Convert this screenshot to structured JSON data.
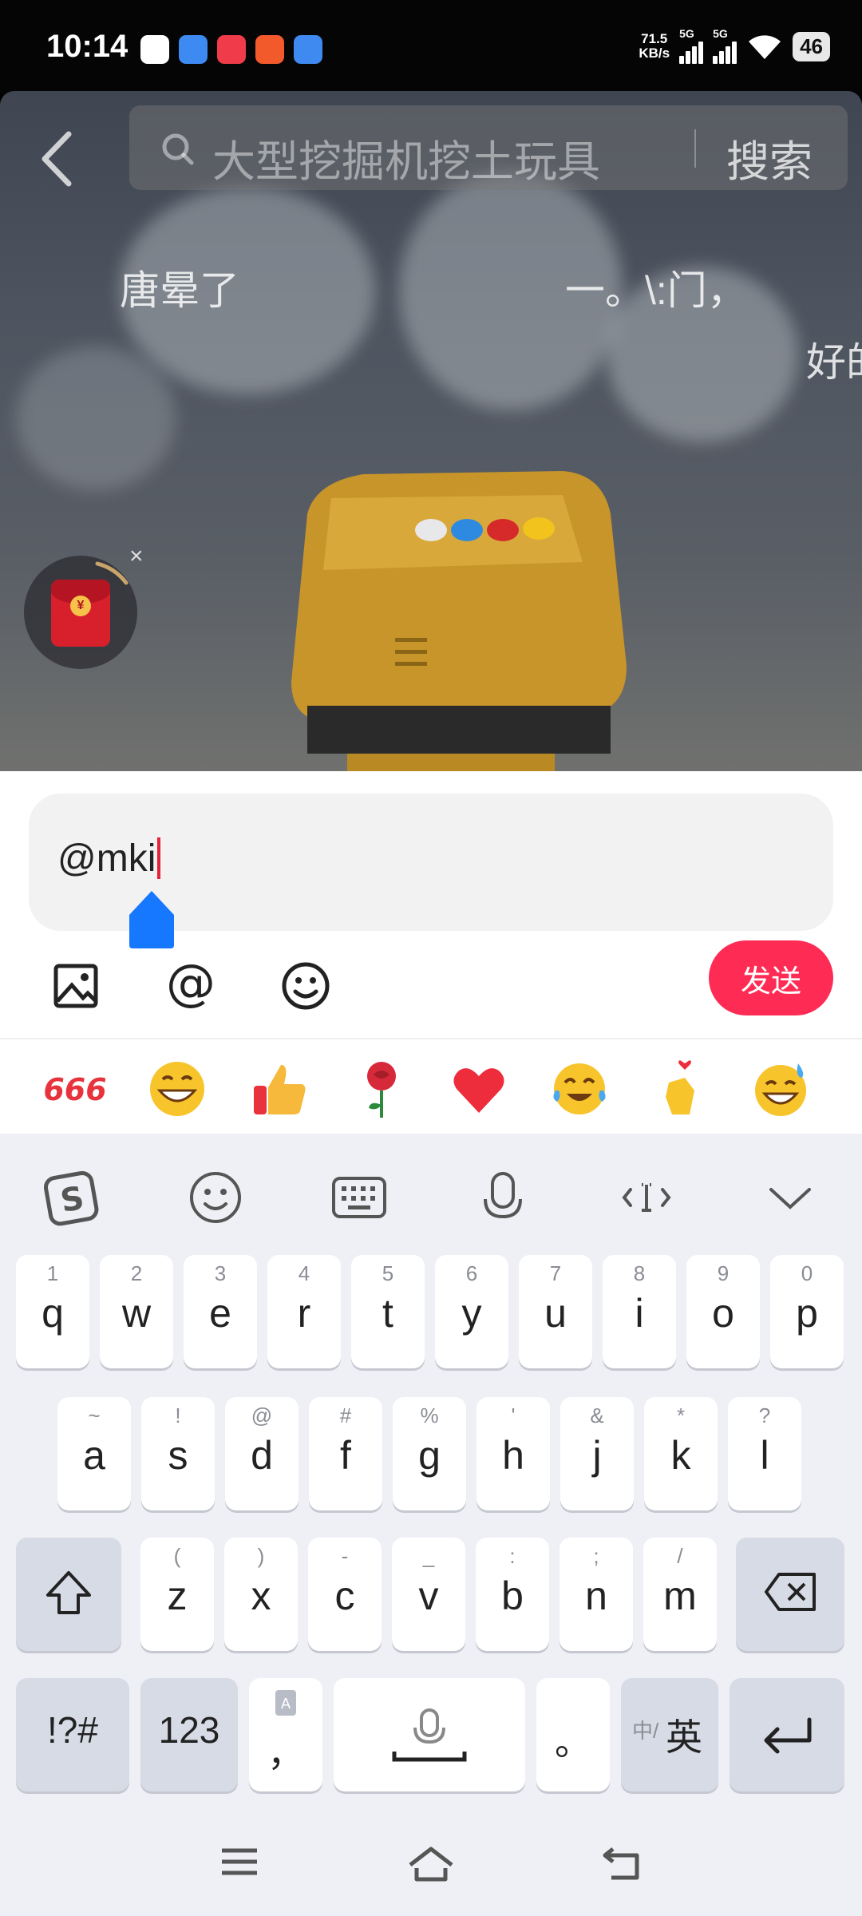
{
  "status_bar": {
    "time": "10:14",
    "speed_value": "71.5",
    "speed_unit": "KB/s",
    "sim1": "5G",
    "sim2": "5G",
    "battery": "46",
    "app_icons": [
      "app-icon-1",
      "app-icon-2",
      "app-icon-3",
      "app-icon-4",
      "app-icon-5"
    ],
    "app_colors": [
      "#ffffff",
      "#3d8bf2",
      "#f03b4a",
      "#f25a2b",
      "#3f8af0"
    ]
  },
  "video": {
    "search_placeholder": "大型挖掘机挖土玩具",
    "search_button": "搜索",
    "danmu": [
      "唐晕了",
      "一。\\:门，",
      "好的"
    ],
    "redpacket_coin": "¥",
    "redpacket_close": "×"
  },
  "comment": {
    "input_value": "@mki",
    "send_label": "发送",
    "tools": [
      "image-icon",
      "at-icon",
      "emoji-icon"
    ],
    "emoji_bar": [
      "666-emoji",
      "grin-emoji",
      "thumbs-up-emoji",
      "rose-emoji",
      "heart-emoji",
      "crying-laugh-emoji",
      "finger-heart-emoji",
      "sweat-smile-emoji"
    ]
  },
  "keyboard": {
    "toolbar": [
      "sogou-logo-icon",
      "emoji-icon",
      "keyboard-icon",
      "mic-icon",
      "cursor-icon",
      "collapse-icon"
    ],
    "row1": [
      {
        "hint": "1",
        "key": "q"
      },
      {
        "hint": "2",
        "key": "w"
      },
      {
        "hint": "3",
        "key": "e"
      },
      {
        "hint": "4",
        "key": "r"
      },
      {
        "hint": "5",
        "key": "t"
      },
      {
        "hint": "6",
        "key": "y"
      },
      {
        "hint": "7",
        "key": "u"
      },
      {
        "hint": "8",
        "key": "i"
      },
      {
        "hint": "9",
        "key": "o"
      },
      {
        "hint": "0",
        "key": "p"
      }
    ],
    "row2": [
      {
        "hint": "~",
        "key": "a"
      },
      {
        "hint": "!",
        "key": "s"
      },
      {
        "hint": "@",
        "key": "d"
      },
      {
        "hint": "#",
        "key": "f"
      },
      {
        "hint": "%",
        "key": "g"
      },
      {
        "hint": "'",
        "key": "h"
      },
      {
        "hint": "&",
        "key": "j"
      },
      {
        "hint": "*",
        "key": "k"
      },
      {
        "hint": "?",
        "key": "l"
      }
    ],
    "row3": [
      {
        "hint": "(",
        "key": "z"
      },
      {
        "hint": ")",
        "key": "x"
      },
      {
        "hint": "-",
        "key": "c"
      },
      {
        "hint": "_",
        "key": "v"
      },
      {
        "hint": ":",
        "key": "b"
      },
      {
        "hint": ";",
        "key": "n"
      },
      {
        "hint": "/",
        "key": "m"
      }
    ],
    "symbols_label": "!?#",
    "num_label": "123",
    "comma_label": "，",
    "period_label": "。",
    "lang_small": "中/",
    "lang_big": "英"
  }
}
